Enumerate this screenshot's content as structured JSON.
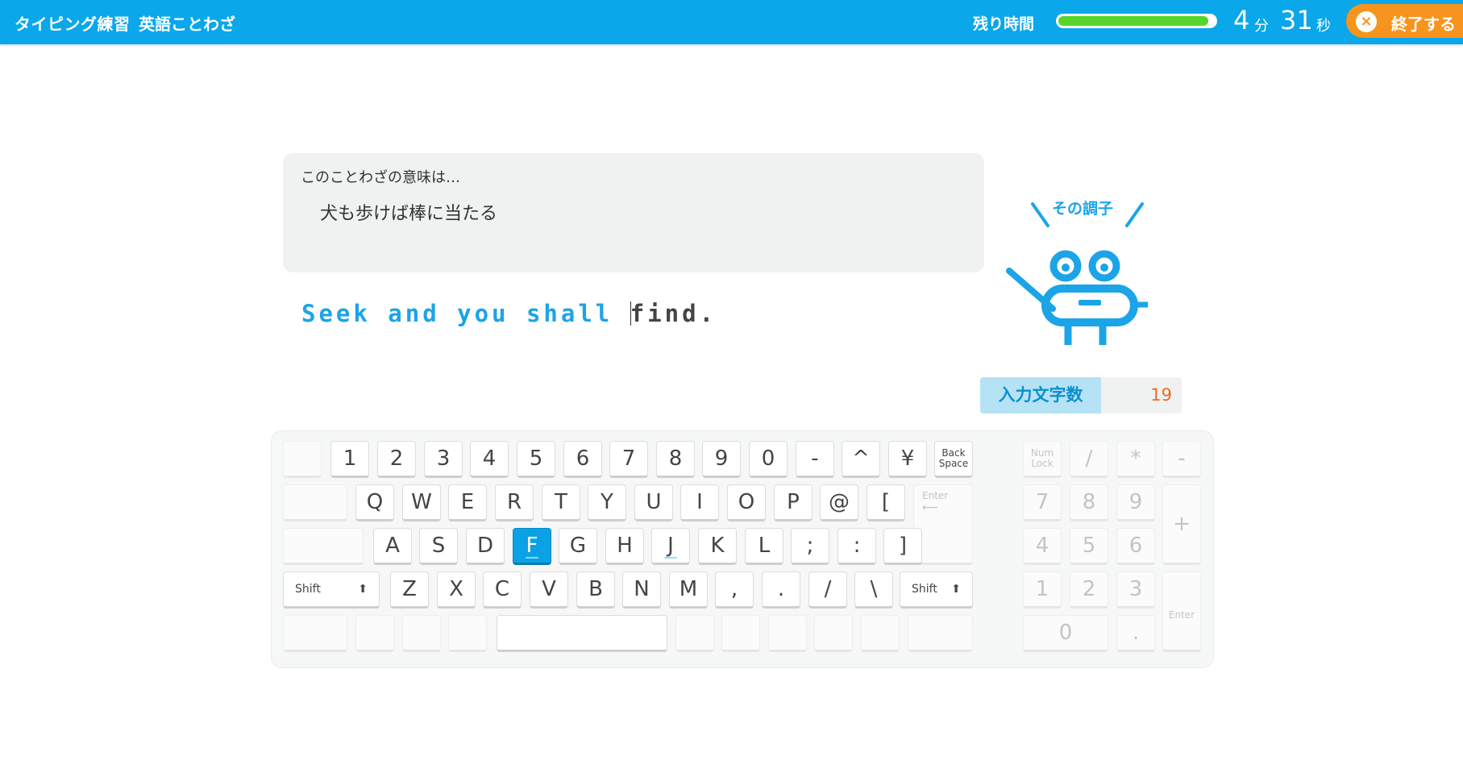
{
  "header": {
    "app_title": "タイピング練習",
    "mode_title": "英語ことわざ",
    "time_label": "残り時間",
    "time_remaining_fraction": 0.96,
    "minutes": "4",
    "minutes_unit": "分",
    "seconds": "31",
    "seconds_unit": "秒",
    "end_icon": "×",
    "end_label": "終了する",
    "accent_color": "#0aa7ea",
    "end_button_color": "#f7941d",
    "bar_fill_color": "#56d62a"
  },
  "meaning": {
    "header": "このことわざの意味は…",
    "text": "犬も歩けば棒に当たる"
  },
  "typing": {
    "typed": "Seek and you shall ",
    "remaining": "find.",
    "typed_color": "#1ba4e8"
  },
  "mascot": {
    "speech": "その調子",
    "icon": "robot-mascot-icon"
  },
  "char_count": {
    "label": "入力文字数",
    "value": "19"
  },
  "keyboard": {
    "highlight_key": "F",
    "highlight_color": "#0aa2e4",
    "row1": [
      "1",
      "2",
      "3",
      "4",
      "5",
      "6",
      "7",
      "8",
      "9",
      "0",
      "-",
      "^",
      "¥"
    ],
    "backspace": "Back Space",
    "row2": [
      "Q",
      "W",
      "E",
      "R",
      "T",
      "Y",
      "U",
      "I",
      "O",
      "P",
      "@",
      "["
    ],
    "enter": "Enter",
    "enter_icon": "return-arrow-icon",
    "row3": [
      "A",
      "S",
      "D",
      "F",
      "G",
      "H",
      "J",
      "K",
      "L",
      ";",
      ":",
      "]"
    ],
    "shift": "Shift",
    "shift_icon": "shift-arrow-icon",
    "row4": [
      "Z",
      "X",
      "C",
      "V",
      "B",
      "N",
      "M",
      ",",
      ".",
      "/",
      "\\"
    ],
    "numpad": {
      "numlock": "Num Lock",
      "top": [
        "/",
        "*",
        "-"
      ],
      "r2": [
        "7",
        "8",
        "9"
      ],
      "plus": "+",
      "r3": [
        "4",
        "5",
        "6"
      ],
      "r4": [
        "1",
        "2",
        "3"
      ],
      "enter": "Enter",
      "zero": "0",
      "dot": "."
    }
  }
}
